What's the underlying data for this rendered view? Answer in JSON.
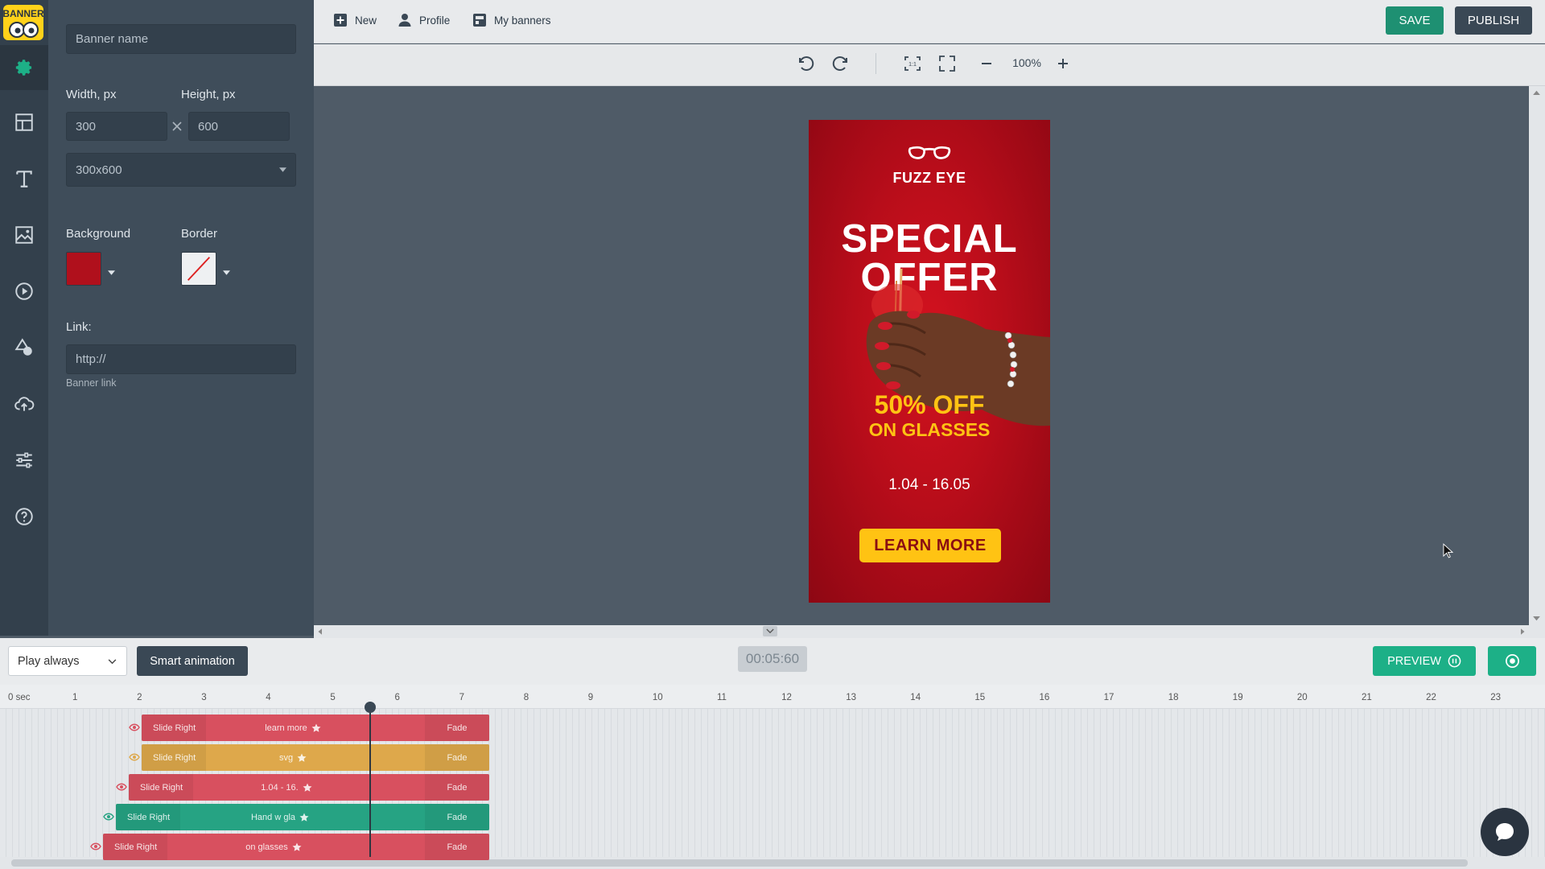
{
  "app": {
    "logo_text": [
      "BANNER",
      "BOO"
    ]
  },
  "colors": {
    "accent_green": "#1db087",
    "save_green": "#1e9072",
    "dark_panel": "#3f4d5a",
    "banner_red": "#c10f1c",
    "offer_yellow": "#ffc313"
  },
  "sidebar": {
    "icons": [
      "gear-icon",
      "layout-icon",
      "text-icon",
      "image-icon",
      "play-icon",
      "shapes-icon",
      "upload-cloud-icon",
      "sliders-icon",
      "help-icon"
    ]
  },
  "panel": {
    "banner_name_placeholder": "Banner name",
    "width_label": "Width, px",
    "height_label": "Height, px",
    "width_value": "300",
    "height_value": "600",
    "size_preset": "300x600",
    "background_label": "Background",
    "border_label": "Border",
    "background_color": "#b0101c",
    "link_label": "Link:",
    "link_placeholder": "http://",
    "link_hint": "Banner link"
  },
  "topbar": {
    "new_label": "New",
    "profile_label": "Profile",
    "my_banners_label": "My banners",
    "save_label": "SAVE",
    "publish_label": "PUBLISH"
  },
  "toolbar": {
    "zoom": "100%"
  },
  "banner": {
    "brand": "FUZZ EYE",
    "headline_line1": "SPECIAL",
    "headline_line2": "OFFER",
    "offer_line1": "50% OFF",
    "offer_line2": "ON GLASSES",
    "dates": "1.04 - 16.05",
    "cta": "LEARN MORE"
  },
  "bottom": {
    "play_mode": "Play always",
    "smart_animation": "Smart animation",
    "timer": "00:05:60",
    "preview_label": "PREVIEW"
  },
  "timeline": {
    "ticks": [
      "0 sec",
      "1",
      "2",
      "3",
      "4",
      "5",
      "6",
      "7",
      "8",
      "9",
      "10",
      "11",
      "12",
      "13",
      "14",
      "15",
      "16",
      "17",
      "18",
      "19",
      "20",
      "21",
      "22",
      "23"
    ],
    "tracks": [
      {
        "in": "Slide Right",
        "name": "learn more",
        "out": "Fade",
        "color": "#d8505f"
      },
      {
        "in": "Slide Right",
        "name": "svg",
        "out": "Fade",
        "color": "#dea84b"
      },
      {
        "in": "Slide Right",
        "name": "1.04 - 16.",
        "out": "Fade",
        "color": "#d8505f"
      },
      {
        "in": "Slide Right",
        "name": "Hand w gla",
        "out": "Fade",
        "color": "#26a383"
      },
      {
        "in": "Slide Right",
        "name": "on glasses",
        "out": "Fade",
        "color": "#d8505f"
      }
    ]
  }
}
